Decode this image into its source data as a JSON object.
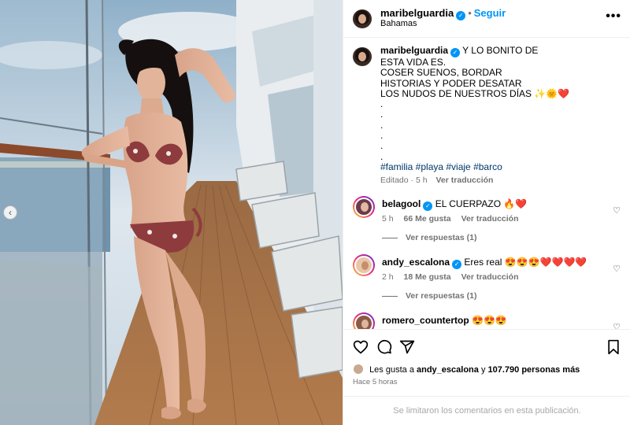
{
  "post": {
    "username": "maribelguardia",
    "follow_label": "Seguir",
    "location": "Bahamas",
    "caption_lines": [
      "Y LO BONITO DE",
      "ESTA VIDA ES.",
      "COSER SUENOS, BORDAR",
      "HISTORIAS Y PODER DESATAR",
      "LOS NUDOS DE NUESTROS DÍAS ✨🌞❤️"
    ],
    "dots": [
      ".",
      ".",
      ".",
      ".",
      ".",
      "."
    ],
    "hashtags": "#familia #playa #viaje #barco",
    "edited_label": "Editado",
    "caption_time": "5 h",
    "translate_label": "Ver traducción"
  },
  "comments": [
    {
      "username": "belagool",
      "verified": true,
      "text": "EL CUERPAZO 🔥❤️",
      "time": "5 h",
      "likes": "66 Me gusta",
      "translate": "Ver traducción",
      "replies": "Ver respuestas (1)",
      "avatar_color": "#6b3b4a"
    },
    {
      "username": "andy_escalona",
      "verified": true,
      "text": "Eres real 😍😍😍❤️❤️❤️❤️",
      "time": "2 h",
      "likes": "18 Me gusta",
      "translate": "Ver traducción",
      "replies": "Ver respuestas (1)",
      "avatar_color": "#e8c7a8"
    },
    {
      "username": "romero_countertop",
      "verified": false,
      "text": "😍😍😍",
      "avatar_color": "#8a5a44"
    }
  ],
  "actions": {
    "likes_prefix": "Les gusta a",
    "likes_user": "andy_escalona",
    "likes_connector": "y",
    "likes_others": "107.790 personas más",
    "time_ago": "Hace 5 horas"
  },
  "footer": {
    "comments_limited": "Se limitaron los comentarios en esta publicación."
  },
  "icons": {
    "more": "more-options-icon",
    "verified": "verified-badge-icon",
    "like": "heart-icon",
    "comment": "comment-icon",
    "share": "share-icon",
    "save": "bookmark-icon",
    "prev": "chevron-left-icon"
  },
  "colors": {
    "accent": "#0095f6",
    "hashtag": "#00376b",
    "muted": "#737373"
  }
}
